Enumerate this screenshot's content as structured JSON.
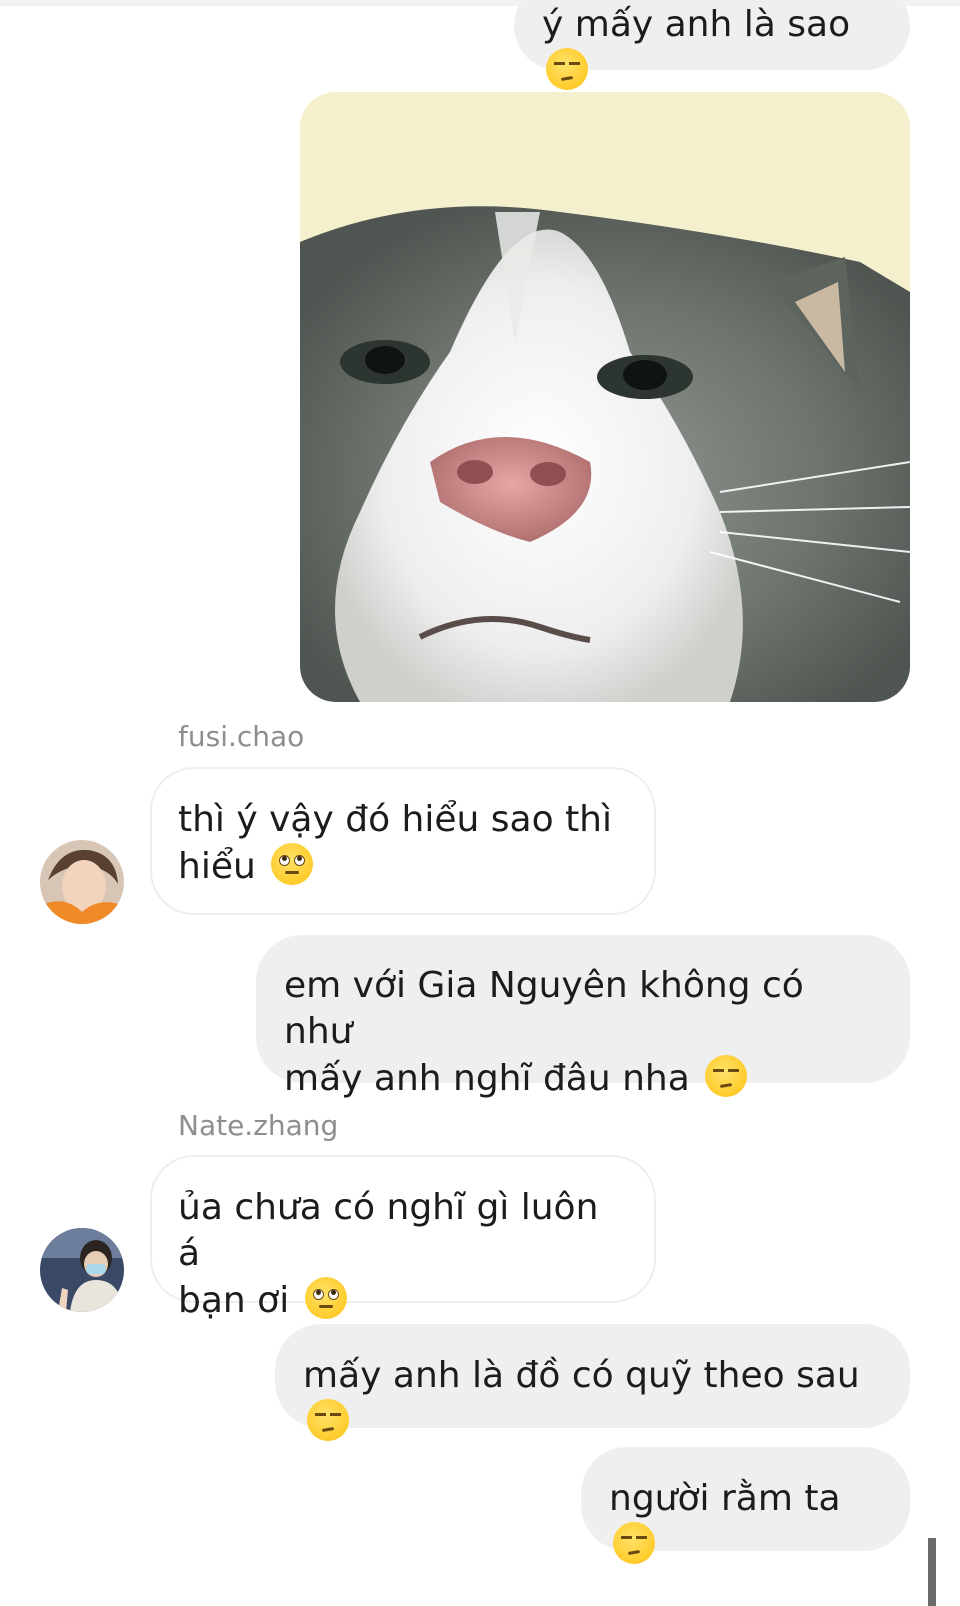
{
  "messages": [
    {
      "id": "m1",
      "direction": "outgoing",
      "text": "ý mấy anh là sao",
      "emoji": "unamused-face-emoji"
    },
    {
      "id": "m2",
      "direction": "outgoing",
      "type": "image",
      "image": "cat-face-photo"
    },
    {
      "id": "m3",
      "direction": "incoming",
      "sender": "fusi.chao",
      "avatar": "avatar-fusi-chao",
      "text": "thì ý vậy đó hiểu sao thì\nhiểu",
      "emoji": "face-with-rolling-eyes-emoji"
    },
    {
      "id": "m4",
      "direction": "outgoing",
      "text": "em với Gia Nguyên không có như\nmấy anh nghĩ đâu nha",
      "emoji": "unamused-face-emoji"
    },
    {
      "id": "m5",
      "direction": "incoming",
      "sender": "Nate.zhang",
      "avatar": "avatar-nate-zhang",
      "text": "ủa chưa có nghĩ gì luôn á\nbạn ơi",
      "emoji": "face-with-rolling-eyes-emoji"
    },
    {
      "id": "m6",
      "direction": "outgoing",
      "text": "mấy anh là đồ có quỹ theo sau",
      "emoji": "unamused-face-emoji"
    },
    {
      "id": "m7",
      "direction": "outgoing",
      "text": "người rằm ta",
      "emoji": "unamused-face-emoji"
    }
  ],
  "colors": {
    "outgoing_bubble": "#efefef",
    "incoming_border": "#eeeeee",
    "sender_name": "#8e8e8e",
    "text": "#1c1c1c"
  }
}
